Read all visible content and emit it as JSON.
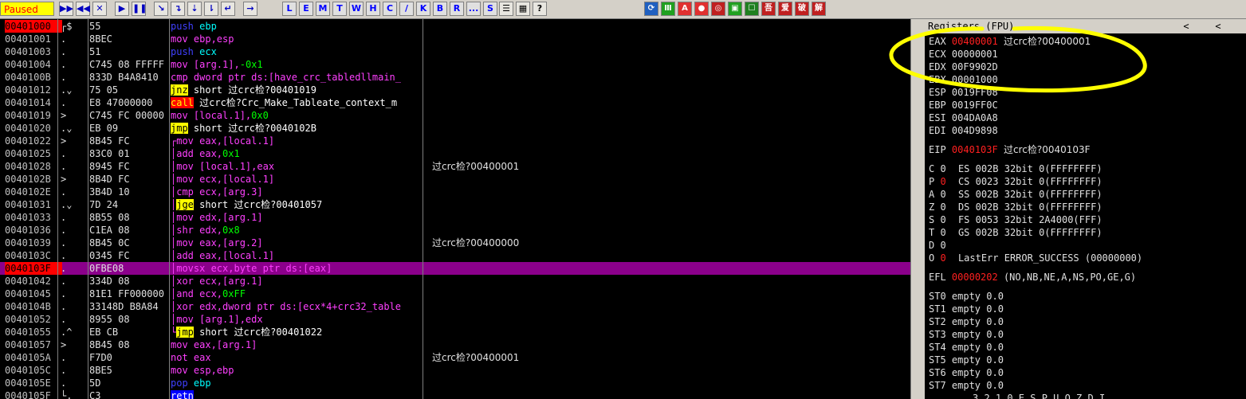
{
  "status": "Paused",
  "toolbar": {
    "buttons": [
      {
        "name": "open-button",
        "glyph": "▶▶"
      },
      {
        "name": "restart-button",
        "glyph": "◀◀"
      },
      {
        "name": "close-button",
        "glyph": "✕"
      },
      {
        "name": "run-button",
        "glyph": "▶"
      },
      {
        "name": "pause-button",
        "glyph": "❚❚"
      },
      {
        "name": "step-into-button",
        "glyph": "↘"
      },
      {
        "name": "step-over-button",
        "glyph": "↴"
      },
      {
        "name": "trace-into-button",
        "glyph": "⇣"
      },
      {
        "name": "trace-over-button",
        "glyph": "⇂"
      },
      {
        "name": "execute-till-return-button",
        "glyph": "↵"
      },
      {
        "name": "goto-button",
        "glyph": "→"
      }
    ],
    "letters": [
      "L",
      "E",
      "M",
      "T",
      "W",
      "H",
      "C",
      "/",
      "K",
      "B",
      "R",
      "...",
      "S"
    ],
    "view_icons": [
      "☰",
      "▦",
      "?"
    ],
    "plugin_icons": [
      "⟳",
      "Ⅲ",
      "A",
      "●",
      "◎",
      "▣",
      "☐",
      "吾",
      "爱",
      "破",
      "解"
    ]
  },
  "rows": [
    {
      "addr": "00401000",
      "mark": "┌$",
      "hex": "55",
      "asm": [
        {
          "t": "push",
          "c": "mn bl"
        },
        {
          "t": " ebp",
          "c": "op c"
        }
      ],
      "cmt": "",
      "addr_class": "red cur"
    },
    {
      "addr": "00401001",
      "mark": ".",
      "hex": "8BEC",
      "asm": [
        {
          "t": "mov",
          "c": "mn m"
        },
        {
          "t": " ebp,esp",
          "c": "op m"
        }
      ],
      "cmt": ""
    },
    {
      "addr": "00401003",
      "mark": ".",
      "hex": "51",
      "asm": [
        {
          "t": "push",
          "c": "mn bl"
        },
        {
          "t": " ecx",
          "c": "op c"
        }
      ],
      "cmt": ""
    },
    {
      "addr": "00401004",
      "mark": ".",
      "hex": "C745 08 FFFFF",
      "asm": [
        {
          "t": "mov",
          "c": "mn m"
        },
        {
          "t": " [arg.1],",
          "c": "op m"
        },
        {
          "t": "-0x1",
          "c": "op"
        }
      ],
      "cmt": ""
    },
    {
      "addr": "0040100B",
      "mark": ".",
      "hex": "833D B4A8410",
      "asm": [
        {
          "t": "cmp",
          "c": "mn m"
        },
        {
          "t": " dword ptr ds:[have_crc_tabledllmain_",
          "c": "op m"
        }
      ],
      "cmt": ""
    },
    {
      "addr": "00401012",
      "mark": ".⌄",
      "hex": "75 05",
      "asm": [
        {
          "t": "jnz",
          "c": "mn y"
        },
        {
          "t": " short 过crc检?00401019",
          "c": "op s"
        }
      ],
      "cmt": ""
    },
    {
      "addr": "00401014",
      "mark": ".",
      "hex": "E8 47000000",
      "asm": [
        {
          "t": "call",
          "c": "mn r"
        },
        {
          "t": " 过crc检?Crc_Make_Tableate_context_m",
          "c": "op s"
        }
      ],
      "cmt": ""
    },
    {
      "addr": "00401019",
      "mark": ">",
      "hex": "C745 FC 00000",
      "asm": [
        {
          "t": "mov",
          "c": "mn m"
        },
        {
          "t": " [local.1],",
          "c": "op m"
        },
        {
          "t": "0x0",
          "c": "op"
        }
      ],
      "cmt": ""
    },
    {
      "addr": "00401020",
      "mark": ".⌄",
      "hex": "EB 09",
      "asm": [
        {
          "t": "jmp",
          "c": "mn y"
        },
        {
          "t": " short 过crc检?0040102B",
          "c": "op s"
        }
      ],
      "cmt": ""
    },
    {
      "addr": "00401022",
      "mark": ">",
      "hex": "8B45 FC",
      "asm": [
        {
          "t": "┌mov",
          "c": "mn m"
        },
        {
          "t": " eax,[local.1]",
          "c": "op m"
        }
      ],
      "cmt": ""
    },
    {
      "addr": "00401025",
      "mark": ".",
      "hex": "83C0 01",
      "asm": [
        {
          "t": "│add",
          "c": "mn m"
        },
        {
          "t": " eax,",
          "c": "op m"
        },
        {
          "t": "0x1",
          "c": "op"
        }
      ],
      "cmt": ""
    },
    {
      "addr": "00401028",
      "mark": ".",
      "hex": "8945 FC",
      "asm": [
        {
          "t": "│mov",
          "c": "mn m"
        },
        {
          "t": " [local.1],eax",
          "c": "op m"
        }
      ],
      "cmt": "过crc检?00400001"
    },
    {
      "addr": "0040102B",
      "mark": ">",
      "hex": "8B4D FC",
      "asm": [
        {
          "t": "│mov",
          "c": "mn m"
        },
        {
          "t": " ecx,[local.1]",
          "c": "op m"
        }
      ],
      "cmt": ""
    },
    {
      "addr": "0040102E",
      "mark": ".",
      "hex": "3B4D 10",
      "asm": [
        {
          "t": "│cmp",
          "c": "mn m"
        },
        {
          "t": " ecx,[arg.3]",
          "c": "op m"
        }
      ],
      "cmt": ""
    },
    {
      "addr": "00401031",
      "mark": ".⌄",
      "hex": "7D 24",
      "asm": [
        {
          "t": "│",
          "c": "mn m"
        },
        {
          "t": "jge",
          "c": "mn y"
        },
        {
          "t": " short 过crc检?00401057",
          "c": "op s"
        }
      ],
      "cmt": ""
    },
    {
      "addr": "00401033",
      "mark": ".",
      "hex": "8B55 08",
      "asm": [
        {
          "t": "│mov",
          "c": "mn m"
        },
        {
          "t": " edx,[arg.1]",
          "c": "op m"
        }
      ],
      "cmt": ""
    },
    {
      "addr": "00401036",
      "mark": ".",
      "hex": "C1EA 08",
      "asm": [
        {
          "t": "│shr",
          "c": "mn m"
        },
        {
          "t": " edx,",
          "c": "op m"
        },
        {
          "t": "0x8",
          "c": "op"
        }
      ],
      "cmt": ""
    },
    {
      "addr": "00401039",
      "mark": ".",
      "hex": "8B45 0C",
      "asm": [
        {
          "t": "│mov",
          "c": "mn m"
        },
        {
          "t": " eax,[arg.2]",
          "c": "op m"
        }
      ],
      "cmt": "过crc检?00400000"
    },
    {
      "addr": "0040103C",
      "mark": ".",
      "hex": "0345 FC",
      "asm": [
        {
          "t": "│add",
          "c": "mn m"
        },
        {
          "t": " eax,[local.1]",
          "c": "op m"
        }
      ],
      "cmt": ""
    },
    {
      "addr": "0040103F",
      "mark": ".",
      "hex": "0FBE08",
      "asm": [
        {
          "t": "│movsx",
          "c": "mn m"
        },
        {
          "t": " ecx,byte ptr ds:[eax]",
          "c": "op m"
        }
      ],
      "cmt": "",
      "hl": true,
      "addr_class": "red cur"
    },
    {
      "addr": "00401042",
      "mark": ".",
      "hex": "334D 08",
      "asm": [
        {
          "t": "│xor",
          "c": "mn m"
        },
        {
          "t": " ecx,[arg.1]",
          "c": "op m"
        }
      ],
      "cmt": ""
    },
    {
      "addr": "00401045",
      "mark": ".",
      "hex": "81E1 FF000000",
      "asm": [
        {
          "t": "│and",
          "c": "mn m"
        },
        {
          "t": " ecx,",
          "c": "op m"
        },
        {
          "t": "0xFF",
          "c": "op"
        }
      ],
      "cmt": ""
    },
    {
      "addr": "0040104B",
      "mark": ".",
      "hex": "33148D B8A84",
      "asm": [
        {
          "t": "│xor",
          "c": "mn m"
        },
        {
          "t": " edx,dword ptr ds:[ecx*4+crc32_table",
          "c": "op m"
        }
      ],
      "cmt": ""
    },
    {
      "addr": "00401052",
      "mark": ".",
      "hex": "8955 08",
      "asm": [
        {
          "t": "│mov",
          "c": "mn m"
        },
        {
          "t": " [arg.1],edx",
          "c": "op m"
        }
      ],
      "cmt": ""
    },
    {
      "addr": "00401055",
      "mark": ".^",
      "hex": "EB CB",
      "asm": [
        {
          "t": "└",
          "c": "mn m"
        },
        {
          "t": "jmp",
          "c": "mn y"
        },
        {
          "t": " short 过crc检?00401022",
          "c": "op s"
        }
      ],
      "cmt": ""
    },
    {
      "addr": "00401057",
      "mark": ">",
      "hex": "8B45 08",
      "asm": [
        {
          "t": "mov",
          "c": "mn m"
        },
        {
          "t": " eax,[arg.1]",
          "c": "op m"
        }
      ],
      "cmt": ""
    },
    {
      "addr": "0040105A",
      "mark": ".",
      "hex": "F7D0",
      "asm": [
        {
          "t": "not",
          "c": "mn m"
        },
        {
          "t": " eax",
          "c": "op m"
        }
      ],
      "cmt": "过crc检?00400001"
    },
    {
      "addr": "0040105C",
      "mark": ".",
      "hex": "8BE5",
      "asm": [
        {
          "t": "mov",
          "c": "mn m"
        },
        {
          "t": " esp,ebp",
          "c": "op m"
        }
      ],
      "cmt": ""
    },
    {
      "addr": "0040105E",
      "mark": ".",
      "hex": "5D",
      "asm": [
        {
          "t": "pop",
          "c": "mn bl"
        },
        {
          "t": " ebp",
          "c": "op c"
        }
      ],
      "cmt": ""
    },
    {
      "addr": "0040105F",
      "mark": "└.",
      "hex": "C3",
      "asm": [
        {
          "t": "retn",
          "c": "mn b"
        }
      ],
      "cmt": ""
    }
  ],
  "registers": {
    "header": "Registers (FPU)",
    "header_arrows": [
      "<",
      "<"
    ],
    "gp": [
      {
        "name": "EAX",
        "value": "00400001",
        "red": true,
        "comment": "过crc检?00400001"
      },
      {
        "name": "ECX",
        "value": "00000001",
        "red": false,
        "comment": ""
      },
      {
        "name": "EDX",
        "value": "00F9902D",
        "red": false,
        "comment": ""
      },
      {
        "name": "EBX",
        "value": "00001000",
        "red": false,
        "comment": ""
      },
      {
        "name": "ESP",
        "value": "0019FF08",
        "red": false,
        "comment": ""
      },
      {
        "name": "EBP",
        "value": "0019FF0C",
        "red": false,
        "comment": ""
      },
      {
        "name": "ESI",
        "value": "004DA0A8",
        "red": false,
        "comment": ""
      },
      {
        "name": "EDI",
        "value": "004D9898",
        "red": false,
        "comment": ""
      }
    ],
    "eip": {
      "name": "EIP",
      "value": "0040103F",
      "red": true,
      "comment": "过crc检?0040103F"
    },
    "flags": [
      {
        "flag": "C",
        "val": "0",
        "red": false,
        "seg": "ES 002B 32bit 0(FFFFFFFF)"
      },
      {
        "flag": "P",
        "val": "0",
        "red": true,
        "seg": "CS 0023 32bit 0(FFFFFFFF)"
      },
      {
        "flag": "A",
        "val": "0",
        "red": false,
        "seg": "SS 002B 32bit 0(FFFFFFFF)"
      },
      {
        "flag": "Z",
        "val": "0",
        "red": false,
        "seg": "DS 002B 32bit 0(FFFFFFFF)"
      },
      {
        "flag": "S",
        "val": "0",
        "red": false,
        "seg": "FS 0053 32bit 2A4000(FFF)"
      },
      {
        "flag": "T",
        "val": "0",
        "red": false,
        "seg": "GS 002B 32bit 0(FFFFFFFF)"
      },
      {
        "flag": "D",
        "val": "0",
        "red": false,
        "seg": ""
      },
      {
        "flag": "O",
        "val": "0",
        "red": true,
        "seg": "LastErr ERROR_SUCCESS (00000000)"
      }
    ],
    "efl": {
      "name": "EFL",
      "value": "00000202",
      "red": true,
      "comment": "(NO,NB,NE,A,NS,PO,GE,G)"
    },
    "fpu": [
      "ST0 empty 0.0",
      "ST1 empty 0.0",
      "ST2 empty 0.0",
      "ST3 empty 0.0",
      "ST4 empty 0.0",
      "ST5 empty 0.0",
      "ST6 empty 0.0",
      "ST7 empty 0.0"
    ],
    "footer": "3 2 1 0      E S P U O Z D I"
  },
  "colors": {
    "annotation": "#ffff00",
    "highlight": "#8b008b",
    "current": "#ff0000"
  }
}
